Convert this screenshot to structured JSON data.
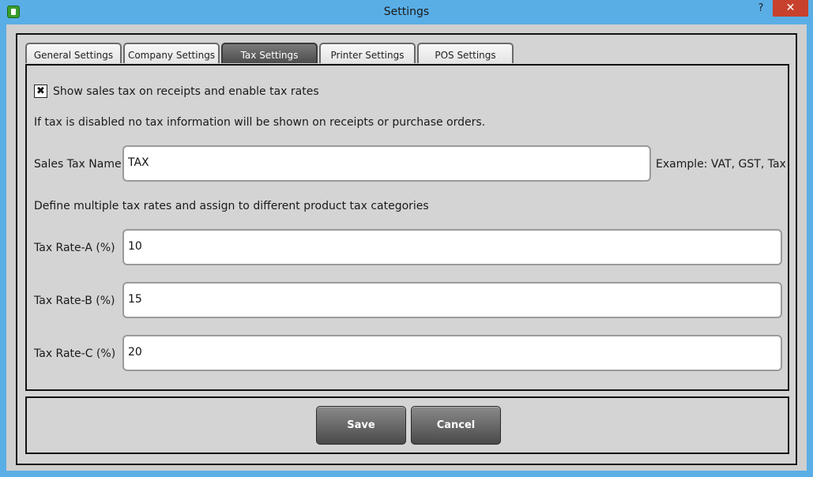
{
  "window": {
    "title": "Settings",
    "help_label": "?",
    "close_label": "✕"
  },
  "tabs": [
    {
      "label": "General Settings"
    },
    {
      "label": "Company Settings"
    },
    {
      "label": "Tax Settings"
    },
    {
      "label": "Printer Settings"
    },
    {
      "label": "POS Settings"
    }
  ],
  "active_tab": "Tax Settings",
  "tax": {
    "enable_checked": "✖",
    "enable_label": "Show sales tax on receipts and enable tax rates",
    "disabled_note": "If tax is disabled no tax information will be shown on receipts or purchase orders.",
    "name_label": "Sales Tax Name",
    "name_value": "TAX",
    "name_example": "Example: VAT, GST, Tax",
    "rates_note": "Define multiple tax rates and assign to different product tax categories",
    "rate_a_label": "Tax Rate-A (%)",
    "rate_a_value": "10",
    "rate_b_label": "Tax Rate-B (%)",
    "rate_b_value": "15",
    "rate_c_label": "Tax Rate-C (%)",
    "rate_c_value": "20"
  },
  "actions": {
    "save_label": "Save",
    "cancel_label": "Cancel"
  }
}
